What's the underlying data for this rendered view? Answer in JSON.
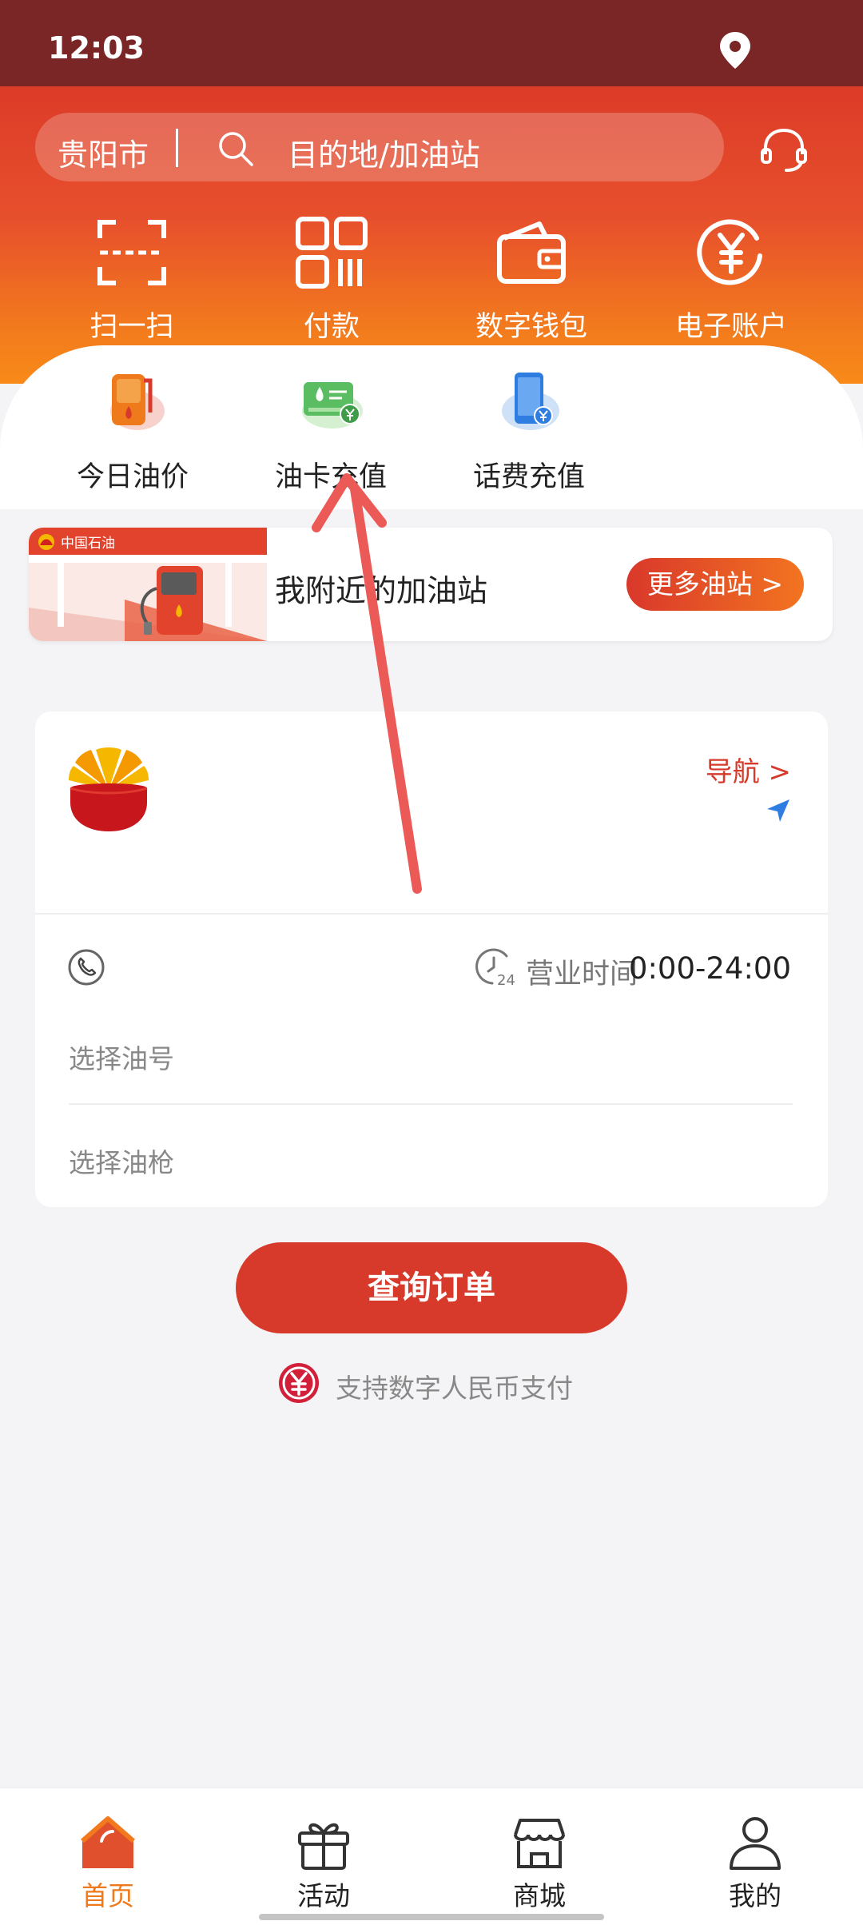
{
  "status_bar": {
    "time": "12:03"
  },
  "search": {
    "city": "贵阳市",
    "placeholder": "目的地/加油站"
  },
  "quick_actions": [
    {
      "label": "扫一扫",
      "icon": "scan-icon"
    },
    {
      "label": "付款",
      "icon": "qr-pay-icon"
    },
    {
      "label": "数字钱包",
      "icon": "wallet-icon"
    },
    {
      "label": "电子账户",
      "icon": "yuan-coin-icon"
    }
  ],
  "sub_actions": [
    {
      "label": "今日油价",
      "icon": "fuel-price-icon"
    },
    {
      "label": "油卡充值",
      "icon": "fuel-card-recharge-icon"
    },
    {
      "label": "话费充值",
      "icon": "phone-recharge-icon"
    }
  ],
  "nearby": {
    "brand": "中国石油",
    "title": "我附近的加油站",
    "more_button": "更多油站 >"
  },
  "station": {
    "nav_label": "导航 >",
    "hours_label": "营业时间",
    "hours_value": "0:00-24:00",
    "select_fuel": "选择油号",
    "select_gun": "选择油枪"
  },
  "query_button": "查询订单",
  "digital_rmb_note": "支持数字人民币支付",
  "tabs": [
    {
      "label": "首页",
      "icon": "home-icon",
      "active": true
    },
    {
      "label": "活动",
      "icon": "gift-icon",
      "active": false
    },
    {
      "label": "商城",
      "icon": "store-icon",
      "active": false
    },
    {
      "label": "我的",
      "icon": "user-icon",
      "active": false
    }
  ],
  "colors": {
    "primary_red": "#d73a2b",
    "orange": "#ef7a1c",
    "status_bar": "#7a2626"
  }
}
